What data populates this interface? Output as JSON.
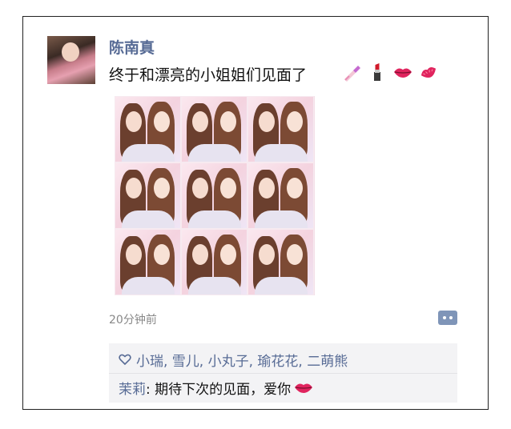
{
  "post": {
    "author": "陈南真",
    "text": "终于和漂亮的小姐姐们见面了",
    "emojis": [
      "nail-polish-icon",
      "lipstick-icon",
      "lips-icon",
      "kiss-mark-icon"
    ],
    "photo_count": 9,
    "timestamp": "20分钟前"
  },
  "likes": {
    "names": "小瑞, 雪儿, 小丸子, 瑜花花, 二萌熊"
  },
  "comment": {
    "author": "茉莉",
    "text": ": 期待下次的见面，爱你",
    "emoji": "lips-icon"
  },
  "colors": {
    "name_blue": "#576b95",
    "comment_bg": "#f3f3f5",
    "more_btn": "#7f95b8"
  }
}
